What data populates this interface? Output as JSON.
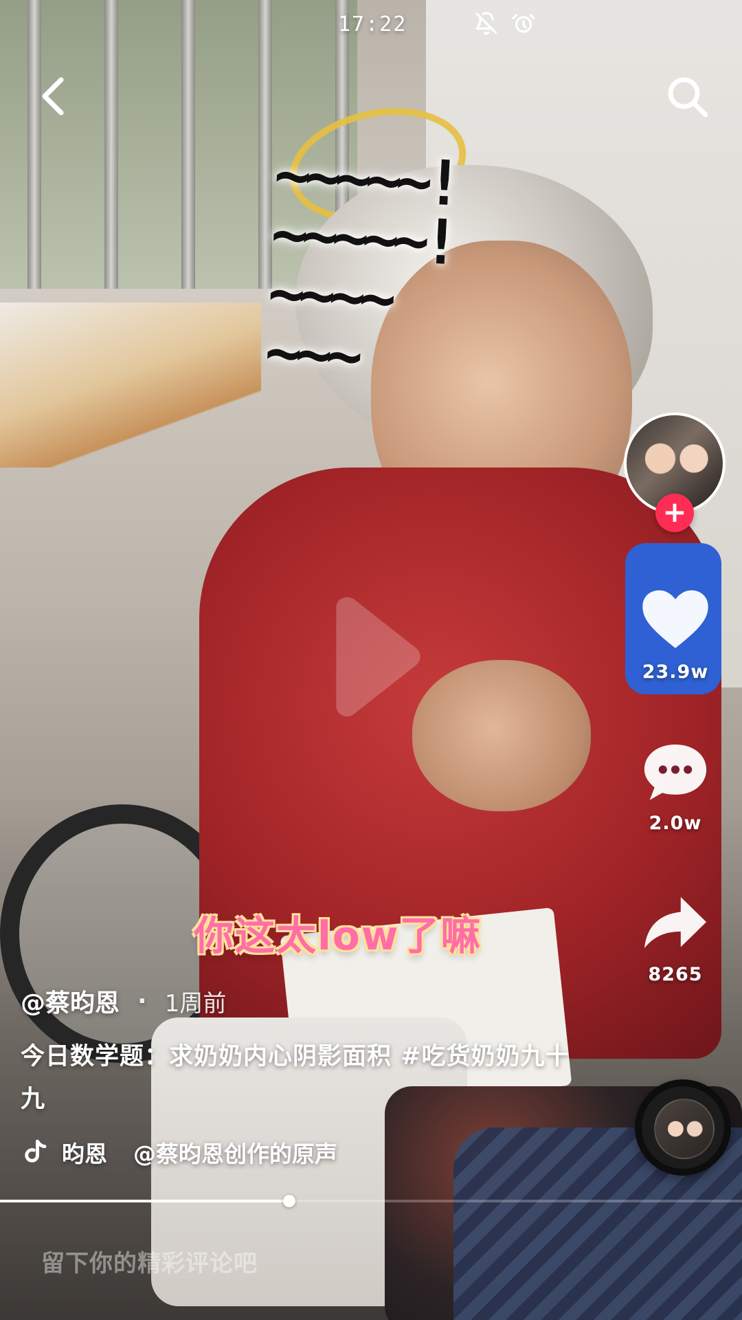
{
  "status_bar": {
    "time": "17:22",
    "icons": [
      "bell-off-icon",
      "alarm-icon"
    ]
  },
  "video_text": {
    "tildes": "~~~~~!\n~~~~~!\n~~~~\n~~~",
    "subtitle": "你这太low了嘛"
  },
  "actions": {
    "like_count": "23.9w",
    "comment_count": "2.0w",
    "share_count": "8265"
  },
  "video_info": {
    "author": "@蔡昀恩",
    "dot": "·",
    "time_ago": "1周前",
    "caption": "今日数学题：求奶奶内心阴影面积 #吃货奶奶九十九",
    "music_artist": "昀恩",
    "music_title": "@蔡昀恩创作的原声"
  },
  "progress": {
    "value": 0.39
  },
  "comment": {
    "placeholder": "留下你的精彩评论吧"
  },
  "colors": {
    "like": "#ffffff",
    "follow": "#ff2d55",
    "subtitle": "#ff6ea6",
    "subtitle_outline": "#ffe09b"
  },
  "icons": {
    "back": "back-arrow-icon",
    "search": "search-icon",
    "play": "play-icon",
    "like": "heart-icon",
    "comment": "comment-bubble-icon",
    "share": "share-arrow-icon",
    "music": "music-note-icon",
    "follow": "plus-icon"
  }
}
